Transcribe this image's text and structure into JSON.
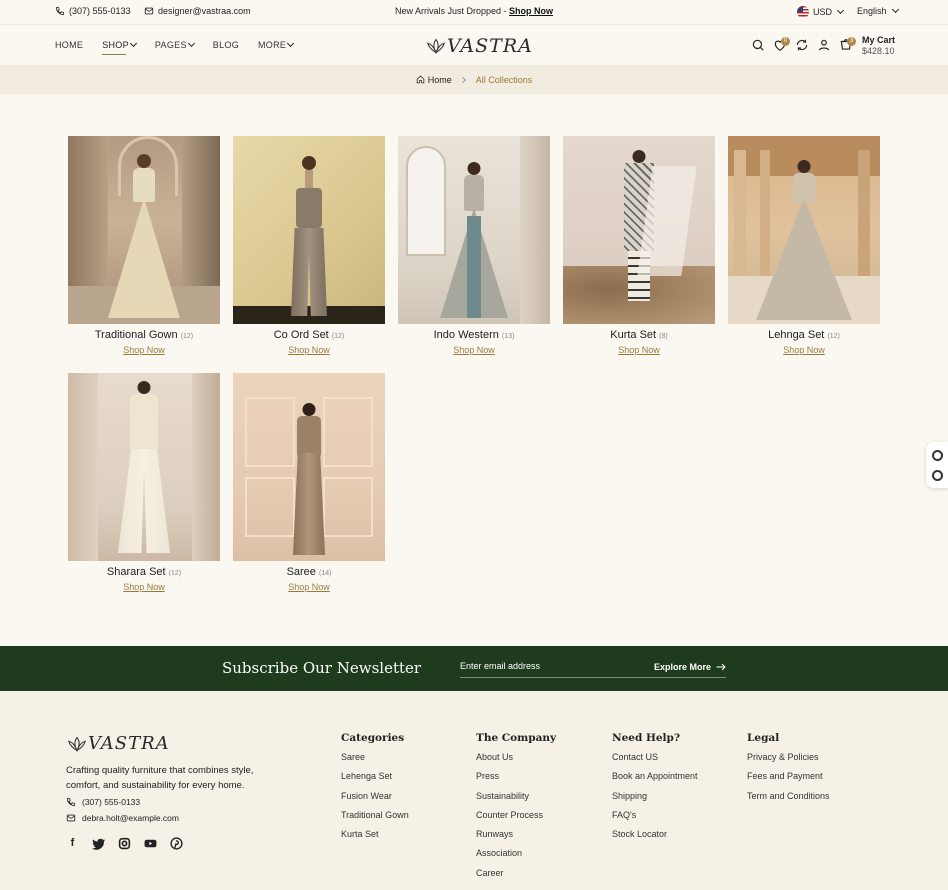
{
  "topbar": {
    "phone": "(307) 555-0133",
    "email": "designer@vastraa.com",
    "promo_text": "New Arrivals Just Dropped - ",
    "promo_link": "Shop Now",
    "currency": "USD",
    "language": "English"
  },
  "header": {
    "nav": [
      "HOME",
      "SHOP",
      "PAGES",
      "BLOG",
      "MORE"
    ],
    "logo": "VASTRA",
    "wishlist_count": "0",
    "cart_count": "3",
    "cart_label": "My Cart",
    "cart_total": "$428.10"
  },
  "breadcrumb": {
    "home": "Home",
    "current": "All Collections"
  },
  "collections": [
    {
      "name": "Traditional Gown",
      "count": "(12)",
      "link": "Shop Now"
    },
    {
      "name": "Co Ord Set",
      "count": "(12)",
      "link": "Shop Now"
    },
    {
      "name": "Indo Western",
      "count": "(13)",
      "link": "Shop Now"
    },
    {
      "name": "Kurta Set",
      "count": "(8)",
      "link": "Shop Now"
    },
    {
      "name": "Lehnga Set",
      "count": "(12)",
      "link": "Shop Now"
    },
    {
      "name": "Sharara Set",
      "count": "(12)",
      "link": "Shop Now"
    },
    {
      "name": "Saree",
      "count": "(14)",
      "link": "Shop Now"
    }
  ],
  "newsletter": {
    "title": "Subscribe Our Newsletter",
    "placeholder": "Enter email address",
    "button": "Explore More"
  },
  "footer": {
    "logo": "VASTRA",
    "description": "Crafting quality furniture that combines style, comfort, and sustainability for every home.",
    "phone": "(307) 555-0133",
    "email": "debra.holt@example.com",
    "columns": [
      {
        "title": "Categories",
        "items": [
          "Saree",
          "Lehenga Set",
          "Fusion Wear",
          "Traditional Gown",
          "Kurta Set"
        ]
      },
      {
        "title": "The Company",
        "items": [
          "About Us",
          "Press",
          "Sustainability",
          "Counter Process",
          "Runways",
          "Association",
          "Career"
        ]
      },
      {
        "title": "Need Help?",
        "items": [
          "Contact US",
          "Book an Appointment",
          "Shipping",
          "FAQ's",
          "Stock Locator"
        ]
      },
      {
        "title": "Legal",
        "items": [
          "Privacy & Policies",
          "Fees and Payment",
          "Term and Conditions"
        ]
      }
    ]
  },
  "colors": {
    "accent": "#9a7b3c",
    "newsletter_bg": "#1e3b1e",
    "page_bg": "#fbf8f2"
  }
}
